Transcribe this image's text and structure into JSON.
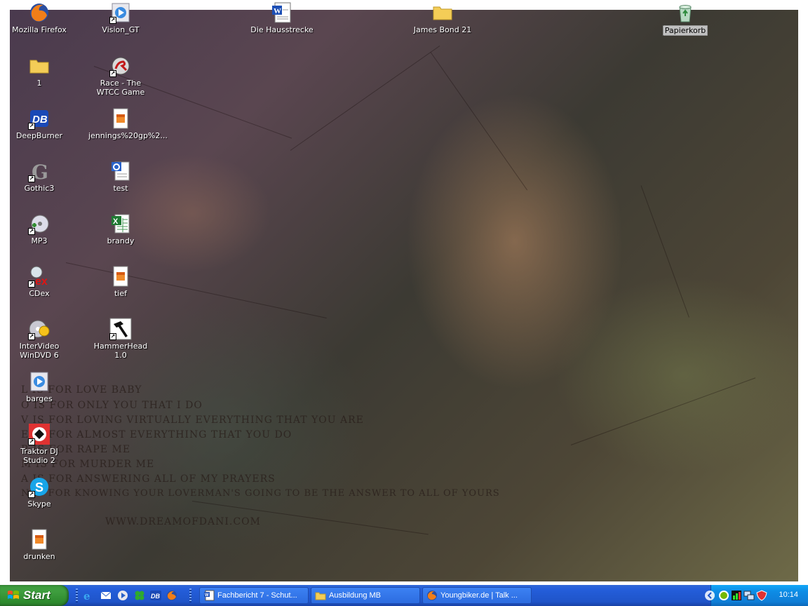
{
  "desktop": {
    "icons": [
      {
        "label": "Mozilla Firefox",
        "icon": "firefox-icon"
      },
      {
        "label": "Vision_GT",
        "icon": "media-player-icon"
      },
      {
        "label": "Die Hausstrecke",
        "icon": "word-document-icon"
      },
      {
        "label": "James Bond 21",
        "icon": "folder-icon"
      },
      {
        "label": "Papierkorb",
        "icon": "recycle-bin-icon"
      },
      {
        "label": "1",
        "icon": "folder-icon"
      },
      {
        "label": "Race - The WTCC Game",
        "icon": "race-game-icon"
      },
      {
        "label": "DeepBurner",
        "icon": "deepburner-icon"
      },
      {
        "label": "jennings%20gp%2...",
        "icon": "audio-file-icon"
      },
      {
        "label": "Gothic3",
        "icon": "gothic-icon"
      },
      {
        "label": "test",
        "icon": "document-icon"
      },
      {
        "label": "MP3",
        "icon": "mp3-icon"
      },
      {
        "label": "brandy",
        "icon": "excel-icon"
      },
      {
        "label": "CDex",
        "icon": "cdex-icon"
      },
      {
        "label": "tief",
        "icon": "audio-file-icon"
      },
      {
        "label": "InterVideo WinDVD 6",
        "icon": "dvd-icon"
      },
      {
        "label": "HammerHead 1.0",
        "icon": "hammer-icon"
      },
      {
        "label": "barges",
        "icon": "media-player-icon"
      },
      {
        "label": "Traktor DJ Studio 2",
        "icon": "traktor-icon"
      },
      {
        "label": "Skype",
        "icon": "skype-icon"
      },
      {
        "label": "drunken",
        "icon": "audio-file-icon"
      }
    ],
    "wallpaper_text": [
      "L is for love baby",
      "O is for only you that I do",
      "V is for loving virtually everything that you are",
      "E is for almost everything that you do",
      "R is for rape me",
      "M is for murder me",
      "A is for answering all of my prayers",
      "N is for knowing your loverman's going to be the answer to all of yours",
      "www.dreamofdani.com"
    ]
  },
  "taskbar": {
    "start_label": "Start",
    "quick_launch": [
      "internet-explorer-icon",
      "outlook-icon",
      "media-player-icon",
      "winamp-icon",
      "deepburner-icon",
      "firefox-icon"
    ],
    "tasks": [
      {
        "label": "Fachbericht 7 - Schut...",
        "icon": "word-document-icon"
      },
      {
        "label": "Ausbildung MB",
        "icon": "folder-icon"
      },
      {
        "label": "Youngbiker.de | Talk ...",
        "icon": "firefox-icon"
      }
    ],
    "tray_icons": [
      "expand-arrow-icon",
      "nvidia-icon",
      "task-manager-icon",
      "network-icon",
      "security-shield-icon"
    ],
    "clock": "10:14"
  },
  "colors": {
    "taskbar_blue": "#245edb",
    "start_green": "#3f9e3f",
    "tray_blue": "#0f7ed6"
  }
}
